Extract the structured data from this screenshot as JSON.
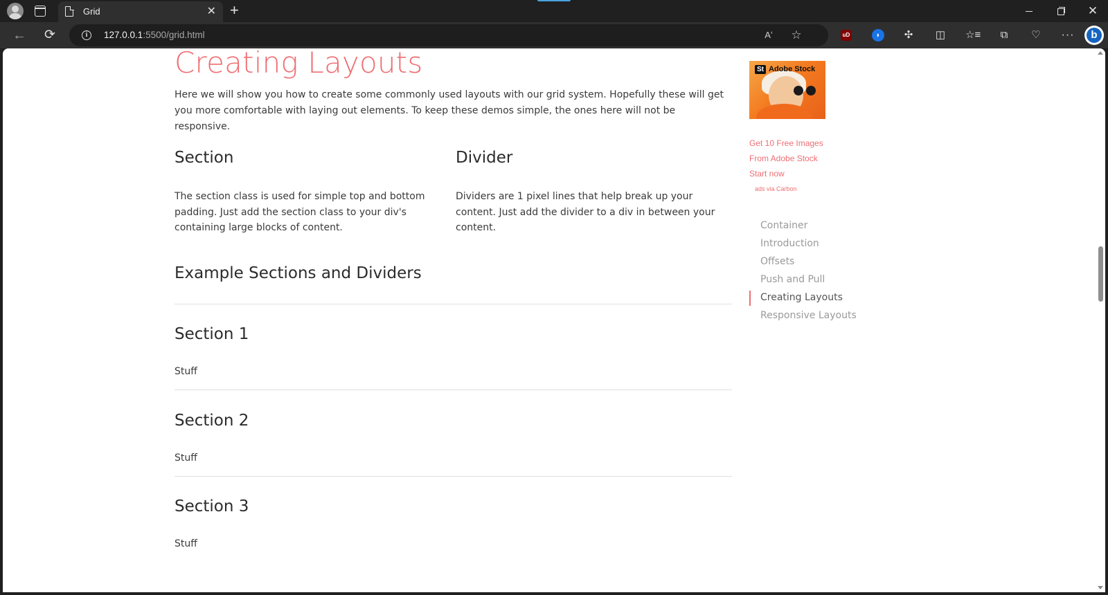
{
  "browser": {
    "tab_title": "Grid",
    "url_host": "127.0.0.1",
    "url_rest": ":5500/grid.html",
    "accent_color": "#4aa3df"
  },
  "icons": {
    "back": "←",
    "refresh": "⟳",
    "read_aloud": "Aʻ",
    "favorite": "☆",
    "ublock": "uD",
    "extension_blue": "◗",
    "puzzle": "✣",
    "split": "◫",
    "favorites_list": "☆≡",
    "collections": "⧉",
    "health": "♡",
    "more": "···",
    "bing": "b",
    "close": "✕",
    "new_tab": "+",
    "info": "i"
  },
  "page": {
    "title": "Creating Layouts",
    "title_color": "#ee6e73",
    "intro": "Here we will show you how to create some commonly used layouts with our grid system. Hopefully these will get you more comfortable with laying out elements. To keep these demos simple, the ones here will not be responsive.",
    "section_heading": "Section",
    "section_text": "The section class is used for simple top and bottom padding. Just add the section class to your div's containing large blocks of content.",
    "divider_heading": "Divider",
    "divider_text": "Dividers are 1 pixel lines that help break up your content. Just add the divider to a div in between your content.",
    "example_heading": "Example Sections and Dividers",
    "examples": [
      {
        "heading": "Section 1",
        "text": "Stuff"
      },
      {
        "heading": "Section 2",
        "text": "Stuff"
      },
      {
        "heading": "Section 3",
        "text": "Stuff"
      }
    ]
  },
  "ad": {
    "brand": "Adobe Stock",
    "brand_mark": "St",
    "line1": "Get 10 Free Images",
    "line2": "From Adobe Stock",
    "line3": "Start now",
    "via": "ads via Carbon"
  },
  "toc": {
    "items": [
      {
        "label": "Container",
        "active": false
      },
      {
        "label": "Introduction",
        "active": false
      },
      {
        "label": "Offsets",
        "active": false
      },
      {
        "label": "Push and Pull",
        "active": false
      },
      {
        "label": "Creating Layouts",
        "active": true
      },
      {
        "label": "Responsive Layouts",
        "active": false
      }
    ]
  }
}
